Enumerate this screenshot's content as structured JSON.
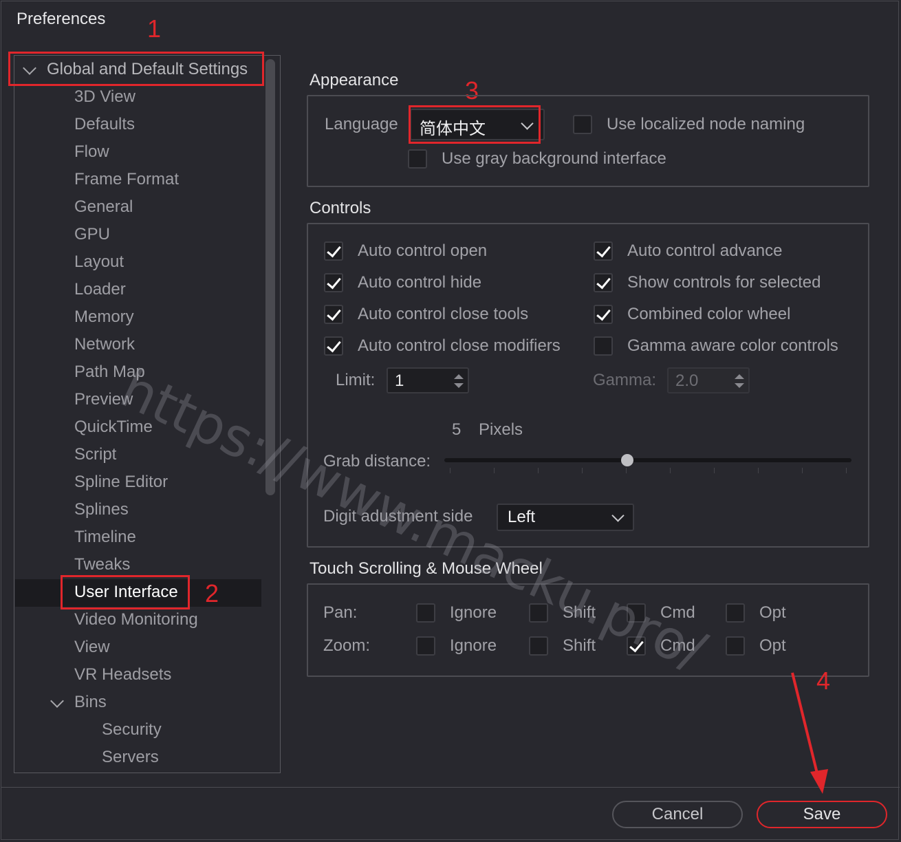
{
  "window": {
    "title": "Preferences"
  },
  "sidebar": {
    "root": {
      "label": "Global and Default Settings"
    },
    "items": [
      "3D View",
      "Defaults",
      "Flow",
      "Frame Format",
      "General",
      "GPU",
      "Layout",
      "Loader",
      "Memory",
      "Network",
      "Path Map",
      "Preview",
      "QuickTime",
      "Script",
      "Spline Editor",
      "Splines",
      "Timeline",
      "Tweaks",
      "User Interface",
      "Video Monitoring",
      "View",
      "VR Headsets"
    ],
    "selected": "User Interface",
    "bins": {
      "label": "Bins",
      "children": [
        "Security",
        "Servers"
      ]
    }
  },
  "annotations": {
    "n1": "1",
    "n2": "2",
    "n3": "3",
    "n4": "4",
    "accent": "#e0262b"
  },
  "appearance": {
    "title": "Appearance",
    "language_label": "Language",
    "language_value": "简体中文",
    "localized_node_naming": {
      "label": "Use localized node naming",
      "checked": false
    },
    "gray_background": {
      "label": "Use gray background interface",
      "checked": false
    }
  },
  "controls": {
    "title": "Controls",
    "left": [
      {
        "label": "Auto control open",
        "checked": true
      },
      {
        "label": "Auto control hide",
        "checked": true
      },
      {
        "label": "Auto control close tools",
        "checked": true
      },
      {
        "label": "Auto control close modifiers",
        "checked": true
      }
    ],
    "right": [
      {
        "label": "Auto control advance",
        "checked": true
      },
      {
        "label": "Show controls for selected",
        "checked": true
      },
      {
        "label": "Combined color wheel",
        "checked": true
      },
      {
        "label": "Gamma aware color controls",
        "checked": false
      }
    ],
    "limit_label": "Limit:",
    "limit_value": "1",
    "gamma_label": "Gamma:",
    "gamma_value": "2.0",
    "grab_value": "5",
    "grab_unit": "Pixels",
    "grab_label": "Grab distance:",
    "grab_fraction": 0.45,
    "digit_label": "Digit adustment side",
    "digit_value": "Left"
  },
  "touch": {
    "title": "Touch Scrolling & Mouse Wheel",
    "options": [
      "Ignore",
      "Shift",
      "Cmd",
      "Opt"
    ],
    "pan": {
      "label": "Pan:",
      "checked": [
        false,
        false,
        false,
        false
      ]
    },
    "zoom": {
      "label": "Zoom:",
      "checked": [
        false,
        false,
        true,
        false
      ]
    }
  },
  "footer": {
    "cancel": "Cancel",
    "save": "Save"
  },
  "watermark": "https://www.macku.pro/"
}
